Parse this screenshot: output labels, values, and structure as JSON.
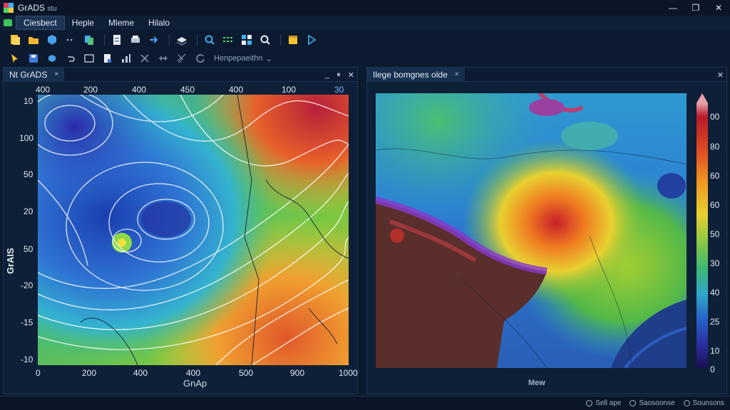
{
  "window": {
    "title": "GrADS",
    "title_suffix": "stu",
    "minimize": "—",
    "maximize": "❐",
    "close": "✕"
  },
  "menu": {
    "items": [
      "Ciesbect",
      "Heple",
      "Mleme",
      "Hilalo"
    ],
    "active_index": 0
  },
  "toolbar2": {
    "label": "Henpepaeithn"
  },
  "left_panel": {
    "tab": "Nt GrADS",
    "tab_close": "×",
    "ctrls": [
      "_",
      "⏸",
      "✕"
    ],
    "x_top_ticks": [
      "400",
      "200",
      "400",
      "450",
      "400",
      "100",
      "30"
    ],
    "y_ticks": [
      "10",
      "100",
      "50",
      "20",
      "50",
      "-20",
      "-15",
      "-10"
    ],
    "x_bottom_ticks": [
      "0",
      "200",
      "400",
      "400",
      "500",
      "900",
      "1000"
    ],
    "ylabel": "GrAIS",
    "xlabel": "GnAp"
  },
  "right_panel": {
    "tab": "Ilege bomgnes olde",
    "tab_close": "×",
    "close": "✕",
    "colorbar_ticks": [
      "00",
      "80",
      "60",
      "60",
      "50",
      "30",
      "40",
      "25",
      "10",
      "0"
    ],
    "footer_label": "Mew"
  },
  "status": {
    "items": [
      "Sell ape",
      "Saosoonse",
      "Sounsons"
    ]
  }
}
